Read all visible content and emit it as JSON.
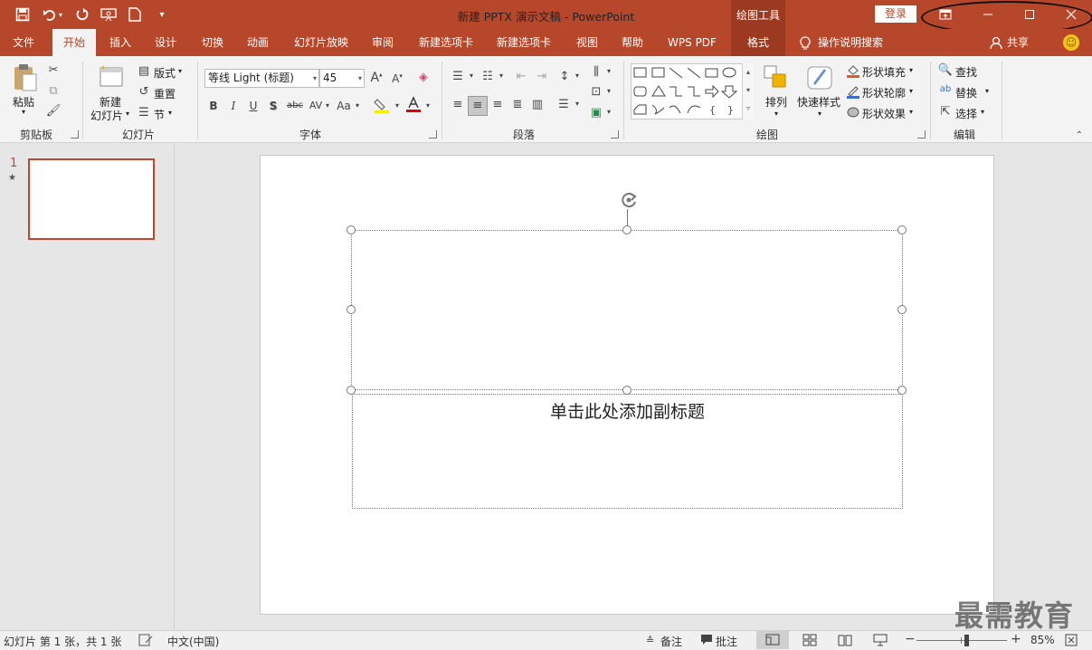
{
  "window": {
    "title": "新建 PPTX 演示文稿  -  PowerPoint",
    "context_tool": "绘图工具",
    "login_label": "登录",
    "controls": {
      "ribbon_display": "⊡",
      "minimize": "—",
      "maximize": "☐",
      "close": "✕"
    }
  },
  "tabs": [
    "文件",
    "开始",
    "插入",
    "设计",
    "切换",
    "动画",
    "幻灯片放映",
    "审阅",
    "新建选项卡",
    "新建选项卡",
    "视图",
    "帮助",
    "WPS PDF",
    "格式"
  ],
  "tell_me": "操作说明搜索",
  "share_label": "共享",
  "ribbon": {
    "clipboard": {
      "paste": "粘贴",
      "group": "剪贴板"
    },
    "slides": {
      "new_slide_line1": "新建",
      "new_slide_line2": "幻灯片",
      "layout": "版式",
      "reset": "重置",
      "section": "节",
      "group": "幻灯片"
    },
    "font": {
      "name": "等线 Light (标题)",
      "size": "45",
      "group": "字体",
      "bold": "B",
      "italic": "I",
      "underline": "U",
      "shadow": "S",
      "strike": "abc",
      "spacing": "AV",
      "case": "Aa",
      "grow": "A",
      "shrink": "A"
    },
    "paragraph": {
      "group": "段落"
    },
    "drawing": {
      "arrange": "排列",
      "quick_styles": "快速样式",
      "fill": "形状填充",
      "outline": "形状轮廓",
      "effects": "形状效果",
      "group": "绘图"
    },
    "editing": {
      "find": "查找",
      "replace": "替换",
      "select": "选择",
      "group": "编辑"
    }
  },
  "thumbnails": [
    {
      "number": "1",
      "marker": "★"
    }
  ],
  "slide": {
    "subtitle_placeholder": "单击此处添加副标题"
  },
  "status": {
    "slide_info": "幻灯片 第 1 张，共 1 张",
    "language": "中文(中国)",
    "notes": "备注",
    "comments": "批注",
    "zoom": "85%",
    "zoom_fraction": 0.55
  },
  "watermark": "最需教育",
  "colors": {
    "brand": "#b7472a",
    "selection": "#c0452a"
  }
}
